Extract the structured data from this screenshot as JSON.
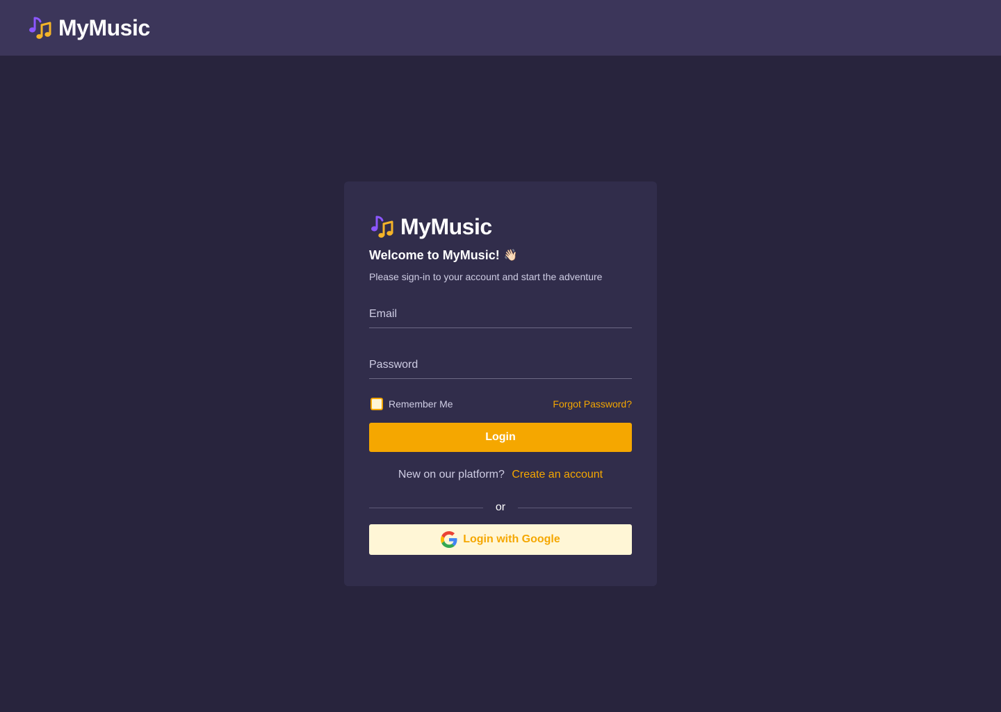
{
  "header": {
    "brand_name": "MyMusic",
    "logo_icon": "music-notes-icon"
  },
  "login_card": {
    "brand_name": "MyMusic",
    "welcome_title": "Welcome to MyMusic!",
    "wave_emoji": "👋🏻",
    "subtitle": "Please sign-in to your account and start the adventure",
    "email": {
      "placeholder": "Email",
      "value": ""
    },
    "password": {
      "placeholder": "Password",
      "value": ""
    },
    "remember_me_label": "Remember Me",
    "remember_me_checked": false,
    "forgot_password_label": "Forgot Password?",
    "login_button_label": "Login",
    "signup_prompt": "New on our platform?",
    "signup_link_label": "Create an account",
    "divider_text": "or",
    "google_button_label": "Login with Google"
  },
  "colors": {
    "page_background": "#28243d",
    "header_background": "#3c365a",
    "card_background": "#312d4b",
    "accent": "#f5a700",
    "logo_purple": "#8c57ff",
    "google_button_background": "#fff6d6"
  }
}
